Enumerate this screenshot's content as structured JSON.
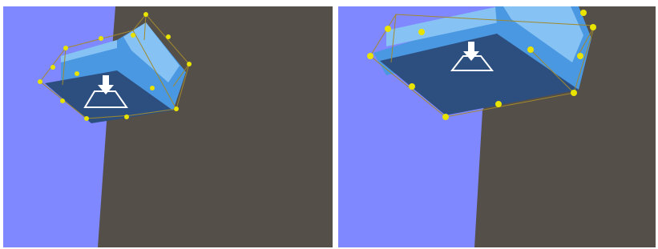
{
  "viewports": [
    {
      "name": "viewport-left",
      "view": "zoomed-out"
    },
    {
      "name": "viewport-right",
      "view": "zoomed-in"
    }
  ],
  "colors": {
    "wall": "#8088ff",
    "floor": "#554f4a",
    "box_front": "#2d4f80",
    "box_side": "#4a98e2",
    "box_highlight": "#86c3f4",
    "bounding_box": "#a0892e",
    "handle": "#e8e400",
    "manipulator": "#ffffff"
  },
  "icons": [
    "move-down-arrow-icon",
    "trapezoid-manipulator-icon",
    "handle-icon"
  ]
}
